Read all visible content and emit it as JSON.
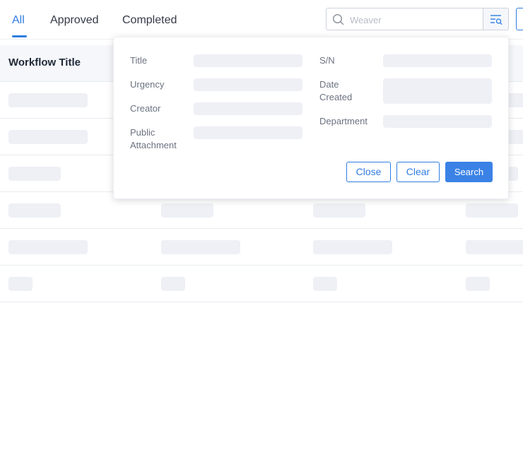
{
  "tabs": [
    {
      "label": "All",
      "active": true
    },
    {
      "label": "Approved",
      "active": false
    },
    {
      "label": "Completed",
      "active": false
    }
  ],
  "search": {
    "placeholder": "Weaver",
    "value": ""
  },
  "table": {
    "column_title": "Workflow Title"
  },
  "advanced_search": {
    "fields": {
      "title": "Title",
      "sn": "S/N",
      "urgency": "Urgency",
      "date_created": "Date Created",
      "creator": "Creator",
      "department": "Department",
      "public_attachment": "Public Attachment"
    },
    "buttons": {
      "close": "Close",
      "clear": "Clear",
      "search": "Search"
    }
  },
  "colors": {
    "accent": "#2f7de1",
    "skeleton": "#eef0f5",
    "header_bg": "#f5f7fb"
  },
  "icons": [
    "search-icon",
    "advanced-filter-icon",
    "more-vertical-icon"
  ]
}
